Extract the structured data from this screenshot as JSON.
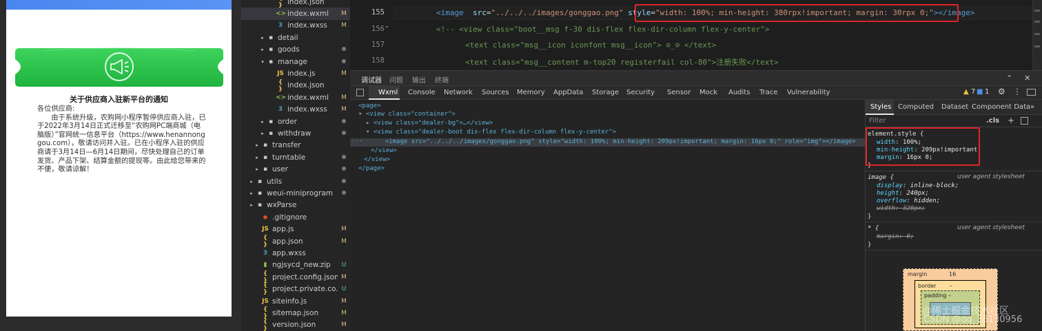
{
  "simulator": {
    "notice_title": "关于供应商入驻新平台的通知",
    "greeting": "各位供应商:",
    "body": "由于系统升级，农购网小程序暂停供应商入驻，已于2022年3月14日正式迁移至“农购网PC端商城（电脑版）”官网统一信息平台（https://www.henannonggou.com），敬请访问并入驻。已在小程序入驻的供应商请于3月14日—6月14日期间，尽快处理自己的订单发货、产品下架、结算金额的提现等。由此给您带来的不便，敬请谅解！"
  },
  "file_tree": {
    "rows": [
      {
        "label": "index.json",
        "icon": "{ }",
        "kind": "json",
        "badge": ""
      },
      {
        "label": "index.wxml",
        "icon": "<>",
        "kind": "wxml",
        "badge": "M"
      },
      {
        "label": "index.wxss",
        "icon": "3",
        "kind": "wxss",
        "badge": "M"
      },
      {
        "label": "detail",
        "icon": "▪",
        "kind": "folder",
        "badge": ""
      },
      {
        "label": "goods",
        "icon": "▪",
        "kind": "folder",
        "badge": "dot"
      },
      {
        "label": "manage",
        "icon": "▪",
        "kind": "folder",
        "badge": "dot"
      },
      {
        "label": "index.js",
        "icon": "JS",
        "kind": "js",
        "badge": "M"
      },
      {
        "label": "index.json",
        "icon": "{ }",
        "kind": "json",
        "badge": ""
      },
      {
        "label": "index.wxml",
        "icon": "<>",
        "kind": "wxml",
        "badge": "M"
      },
      {
        "label": "index.wxss",
        "icon": "3",
        "kind": "wxss",
        "badge": "M"
      },
      {
        "label": "order",
        "icon": "▪",
        "kind": "folder",
        "badge": "dot"
      },
      {
        "label": "withdraw",
        "icon": "▪",
        "kind": "folder",
        "badge": "dot"
      },
      {
        "label": "transfer",
        "icon": "▪",
        "kind": "folder",
        "badge": ""
      },
      {
        "label": "turntable",
        "icon": "▪",
        "kind": "folder",
        "badge": "dot"
      },
      {
        "label": "user",
        "icon": "▪",
        "kind": "folder",
        "badge": "dot"
      },
      {
        "label": "utils",
        "icon": "▪",
        "kind": "folder",
        "badge": "dot"
      },
      {
        "label": "weui-miniprogram",
        "icon": "▪",
        "kind": "folder",
        "badge": "dot"
      },
      {
        "label": "wxParse",
        "icon": "▪",
        "kind": "folder",
        "badge": ""
      },
      {
        "label": ".gitignore",
        "icon": "◆",
        "kind": "git",
        "badge": ""
      },
      {
        "label": "app.js",
        "icon": "JS",
        "kind": "js",
        "badge": "M"
      },
      {
        "label": "app.json",
        "icon": "{ }",
        "kind": "json",
        "badge": "M"
      },
      {
        "label": "app.wxss",
        "icon": "3",
        "kind": "wxss",
        "badge": ""
      },
      {
        "label": "ngjsycd_new.zip",
        "icon": "▮",
        "kind": "zip",
        "badge": "U"
      },
      {
        "label": "project.config.json",
        "icon": "{ }",
        "kind": "json",
        "badge": "M"
      },
      {
        "label": "project.private.co...",
        "icon": "{ }",
        "kind": "json",
        "badge": "U"
      },
      {
        "label": "siteinfo.js",
        "icon": "JS",
        "kind": "js",
        "badge": "M"
      },
      {
        "label": "sitemap.json",
        "icon": "{ }",
        "kind": "json",
        "badge": "M"
      },
      {
        "label": "version.json",
        "icon": "{ }",
        "kind": "json",
        "badge": "M"
      }
    ]
  },
  "editor": {
    "lines": [
      {
        "num": "155",
        "tag_open": "<image",
        "attr1": "src",
        "str1": "\"../../../images/gonggao.png\"",
        "attr2": "style",
        "str2": "\"width: 100%; min-height: 380rpx!important; margin: 30rpx 0;\"",
        "tag_close": "></image>"
      },
      {
        "num": "156",
        "comment": "<!-- <view class=\"boot__msg f-30 dis-flex flex-dir-column flex-y-center\">"
      },
      {
        "num": "157",
        "comment": "<text class=\"msg__icon iconfont msg__icon\"> ⊙_⊙ </text>"
      },
      {
        "num": "158",
        "comment": "<text class=\"msg__content m-top20 registerfail col-80\">注册失败</text>"
      }
    ]
  },
  "devtools": {
    "top_tabs": [
      "调试器",
      "问题",
      "输出",
      "终端"
    ],
    "panel_tabs": [
      "Wxml",
      "Console",
      "Network",
      "Sources",
      "Memory",
      "AppData",
      "Storage",
      "Security",
      "Sensor",
      "Mock",
      "Audits",
      "Trace",
      "Vulnerability"
    ],
    "warn_count": "7",
    "info_count": "1",
    "wxml": {
      "page_open": "<page>",
      "container": "<view class=\"container\">",
      "dealer_bg": "<view class=\"dealer-bg\">…</view>",
      "dealer_boot": "<view class=\"dealer-boot dis-flex flex-dir-column flex-y-center\">",
      "image_line": "<image src=\"../../../images/gonggao.png\" style=\"width: 100%; min-height: 209px!important; margin: 16px 0;\" role=\"img\"></image>",
      "view_close": "</view>",
      "view_close2": "</view>",
      "page_close": "</page>"
    },
    "styles": {
      "tabs": [
        "Styles",
        "Computed",
        "Dataset",
        "Component Data"
      ],
      "filter_placeholder": "Filter",
      "cls": ".cls",
      "element_style": {
        "selector": "element.style {",
        "props": [
          {
            "name": "width",
            "value": "100%;"
          },
          {
            "name": "min-height",
            "value": "209px!important;"
          },
          {
            "name": "margin",
            "value": "16px 0;"
          }
        ]
      },
      "image_rule": {
        "selector": "image {",
        "source": "user agent stylesheet",
        "props": [
          {
            "name": "display",
            "value": "inline-block;"
          },
          {
            "name": "height",
            "value": "240px;"
          },
          {
            "name": "overflow",
            "value": "hidden;"
          },
          {
            "name": "width",
            "value": "320px;"
          }
        ]
      },
      "star_rule": {
        "selector": "* {",
        "source": "user agent stylesheet",
        "props": [
          {
            "name": "margin",
            "value": "0;"
          }
        ]
      },
      "box_model": {
        "margin_label": "margin",
        "margin_value": "16",
        "border_label": "border",
        "border_value": "–",
        "padding_label": "padding –"
      }
    }
  },
  "watermark": {
    "line1": "@稀土掘金技术社区",
    "line2": "CSDN @qq_38130956"
  }
}
